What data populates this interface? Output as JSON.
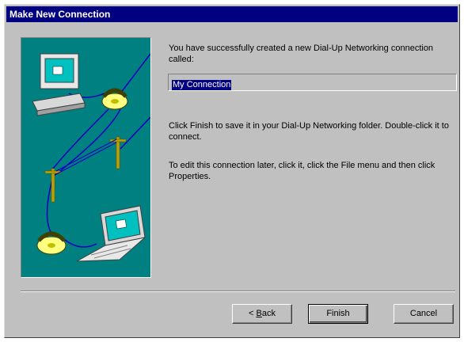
{
  "window": {
    "title": "Make New Connection"
  },
  "content": {
    "success_message": "You have successfully created a new Dial-Up Networking connection called:",
    "connection_name": "My Connection",
    "finish_instructions": "Click Finish to save it in your Dial-Up Networking folder. Double-click it to connect.",
    "edit_instructions": "To edit this connection later, click it, click the File menu and then click Properties."
  },
  "buttons": {
    "back_prefix": "< ",
    "back_accel": "B",
    "back_rest": "ack",
    "finish": "Finish",
    "cancel": "Cancel"
  },
  "colors": {
    "title_bar": "#000080",
    "dialog_face": "#c0c0c0",
    "illustration_bg": "#008080"
  },
  "icons": {
    "illustration": [
      "computer-icon",
      "telephone-icon",
      "telephone-pole-icon",
      "laptop-icon"
    ]
  }
}
